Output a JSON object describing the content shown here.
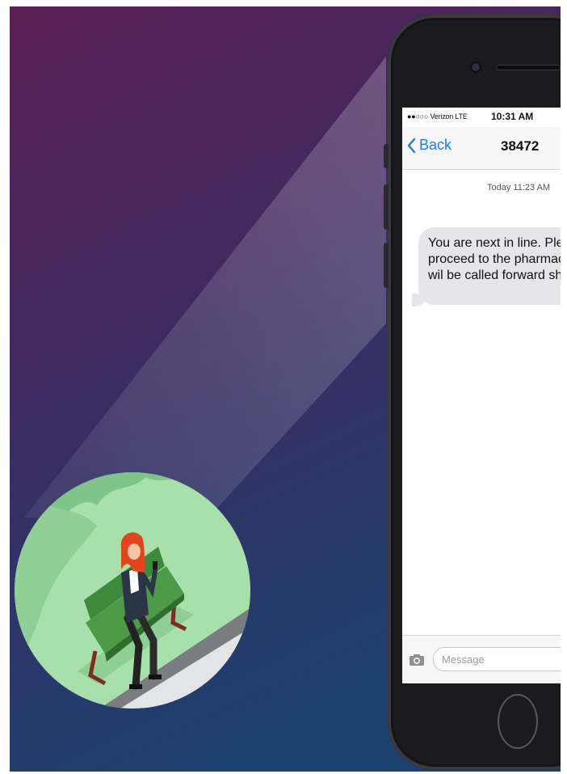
{
  "status_bar": {
    "carrier": "●●○○○ Verizon LTE",
    "time": "10:31 AM"
  },
  "nav": {
    "back_label": "Back",
    "title": "38472"
  },
  "thread": {
    "timestamp": "Today 11:23 AM",
    "message_lines": [
      "You are next in line. Ple",
      "proceed to the pharmac",
      "wil be called forward sh"
    ]
  },
  "compose": {
    "placeholder": "Message"
  },
  "icons": {
    "back": "chevron-left-icon",
    "camera": "camera-icon"
  },
  "colors": {
    "background_top": "#5a2052",
    "background_bottom": "#1c3f6e",
    "ios_blue": "#1b7cf5",
    "bubble_gray": "#e6e6ea",
    "scene_green": "#a6dfa9",
    "bench_green": "#3f8a3c"
  }
}
